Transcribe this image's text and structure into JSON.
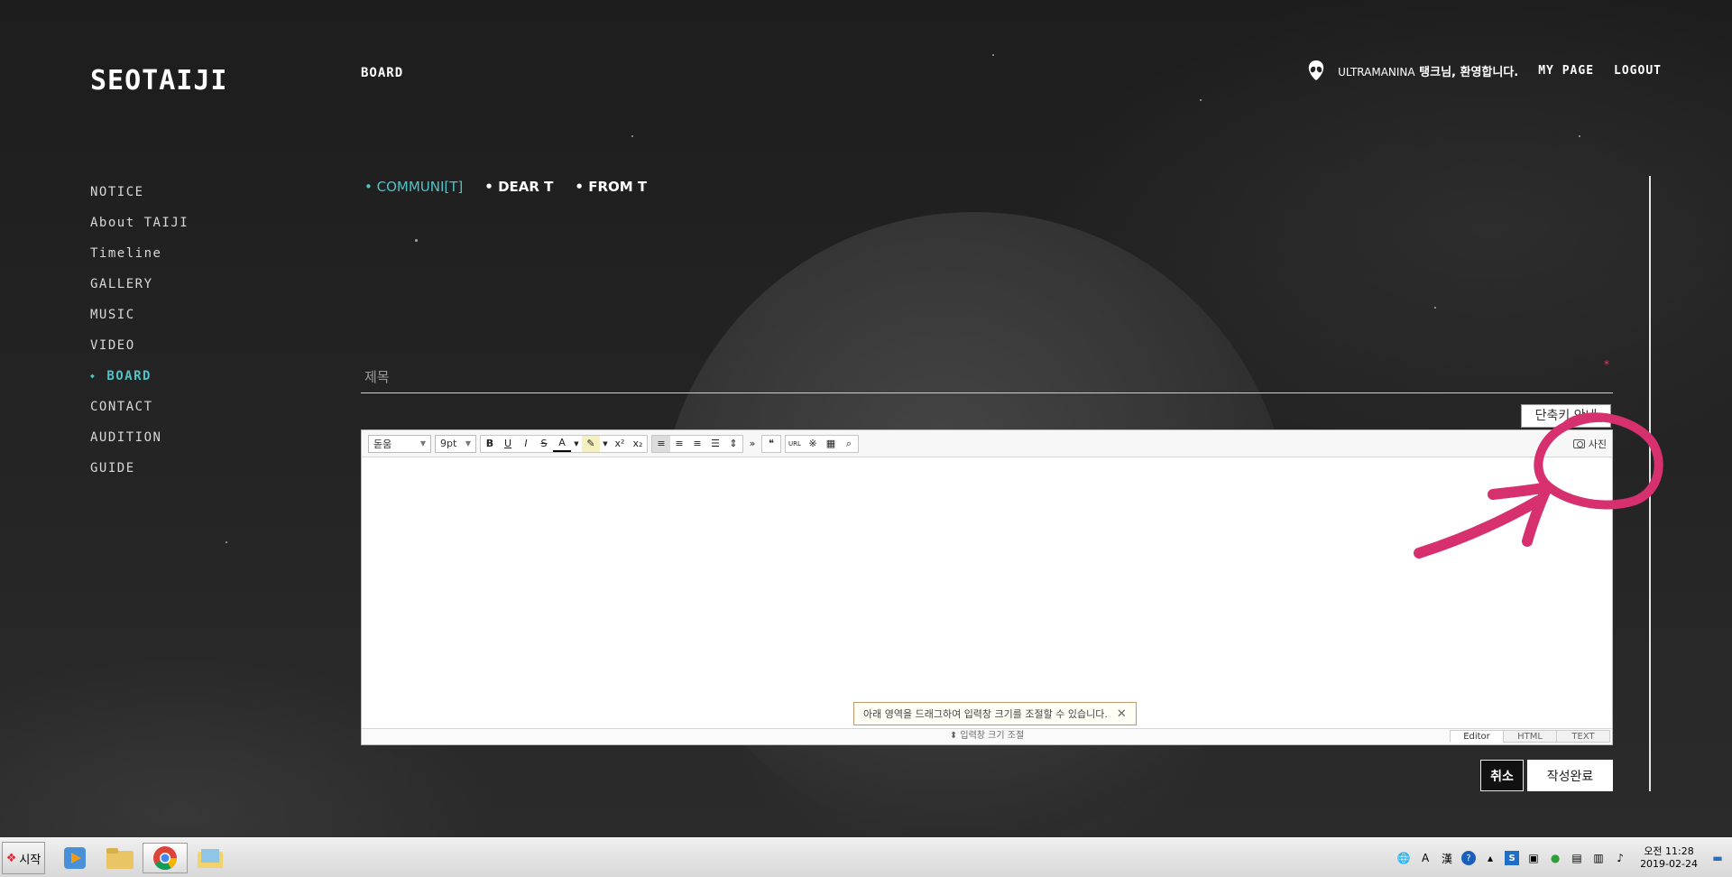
{
  "header": {
    "logo": "SEOTAIJI",
    "nav_board": "BOARD",
    "user_name": "ULTRAMANINA",
    "greeting_suffix": " 탱크님, 환영합니다.",
    "my_page": "MY PAGE",
    "logout": "LOGOUT"
  },
  "left_menu": {
    "items": [
      "NOTICE",
      "About TAIJI",
      "Timeline",
      "GALLERY",
      "MUSIC",
      "VIDEO",
      "BOARD",
      "CONTACT",
      "AUDITION",
      "GUIDE"
    ],
    "active": "BOARD"
  },
  "subtabs": {
    "items": [
      "COMMUNI[T]",
      "DEAR T",
      "FROM T"
    ],
    "active": "COMMUNI[T]"
  },
  "form": {
    "title_placeholder": "제목",
    "required_mark": "*",
    "shortcut_button": "단축키 안내"
  },
  "editor": {
    "font_select": "돋움",
    "size_select": "9pt",
    "photo_label": "사진",
    "tooltip": "아래 영역을 드래그하여 입력창 크기를 조절할 수 있습니다.",
    "resize_label": "⬍ 입력창 크기 조절",
    "modes": [
      "Editor",
      "HTML",
      "TEXT"
    ],
    "active_mode": "Editor"
  },
  "buttons": {
    "cancel": "취소",
    "submit": "작성완료"
  },
  "colors": {
    "accent": "#4fc3c8",
    "annotation": "#d6306f"
  },
  "taskbar": {
    "start": "시작",
    "ime_a": "A",
    "ime_han": "漢",
    "clock_ampm_time": "오전 11:28",
    "clock_date": "2019-02-24"
  }
}
